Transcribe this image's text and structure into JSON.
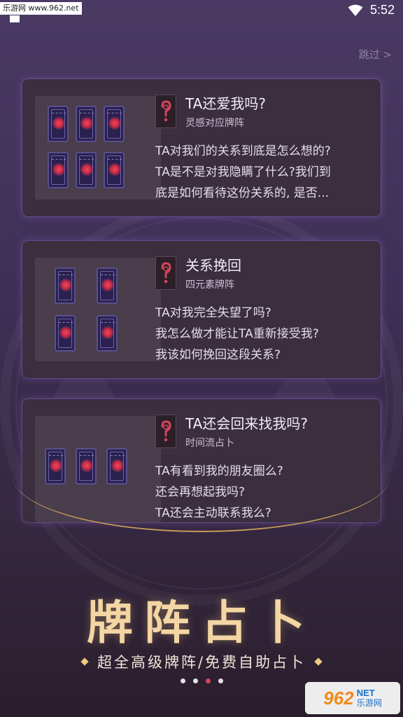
{
  "status_bar": {
    "time": "5:52",
    "watermark": "乐游网 www.962.net"
  },
  "skip_label": "跳过 >",
  "spreads": [
    {
      "title": "TA还爱我吗?",
      "subtitle": "灵感对应牌阵",
      "lines": [
        "TA对我们的关系到底是怎么想的?",
        "TA是不是对我隐瞒了什么?我们到",
        "底是如何看待这份关系的, 是否..."
      ]
    },
    {
      "title": "关系挽回",
      "subtitle": "四元素牌阵",
      "lines": [
        "TA对我完全失望了吗?",
        "我怎么做才能让TA重新接受我?",
        "我该如何挽回这段关系?"
      ]
    },
    {
      "title": "TA还会回来找我吗?",
      "subtitle": "时间流占卜",
      "lines": [
        "TA有看到我的朋友圈么?",
        "还会再想起我吗?",
        "TA还会主动联系我么?"
      ]
    }
  ],
  "headline": "牌阵占卜",
  "tagline": "超全高级牌阵/免费自助占卜",
  "pager": {
    "count": 4,
    "active_index": 2
  },
  "bottom_watermark": {
    "number": "962",
    "net": "NET",
    "sub": "乐游网"
  },
  "colors": {
    "accent": "#d7445a",
    "gold": "#f3d6a3",
    "card_bg": "#3a2e3f"
  },
  "icons": [
    "wifi-icon",
    "question-mark-icon",
    "diamond-icon",
    "tarot-card-icon"
  ]
}
